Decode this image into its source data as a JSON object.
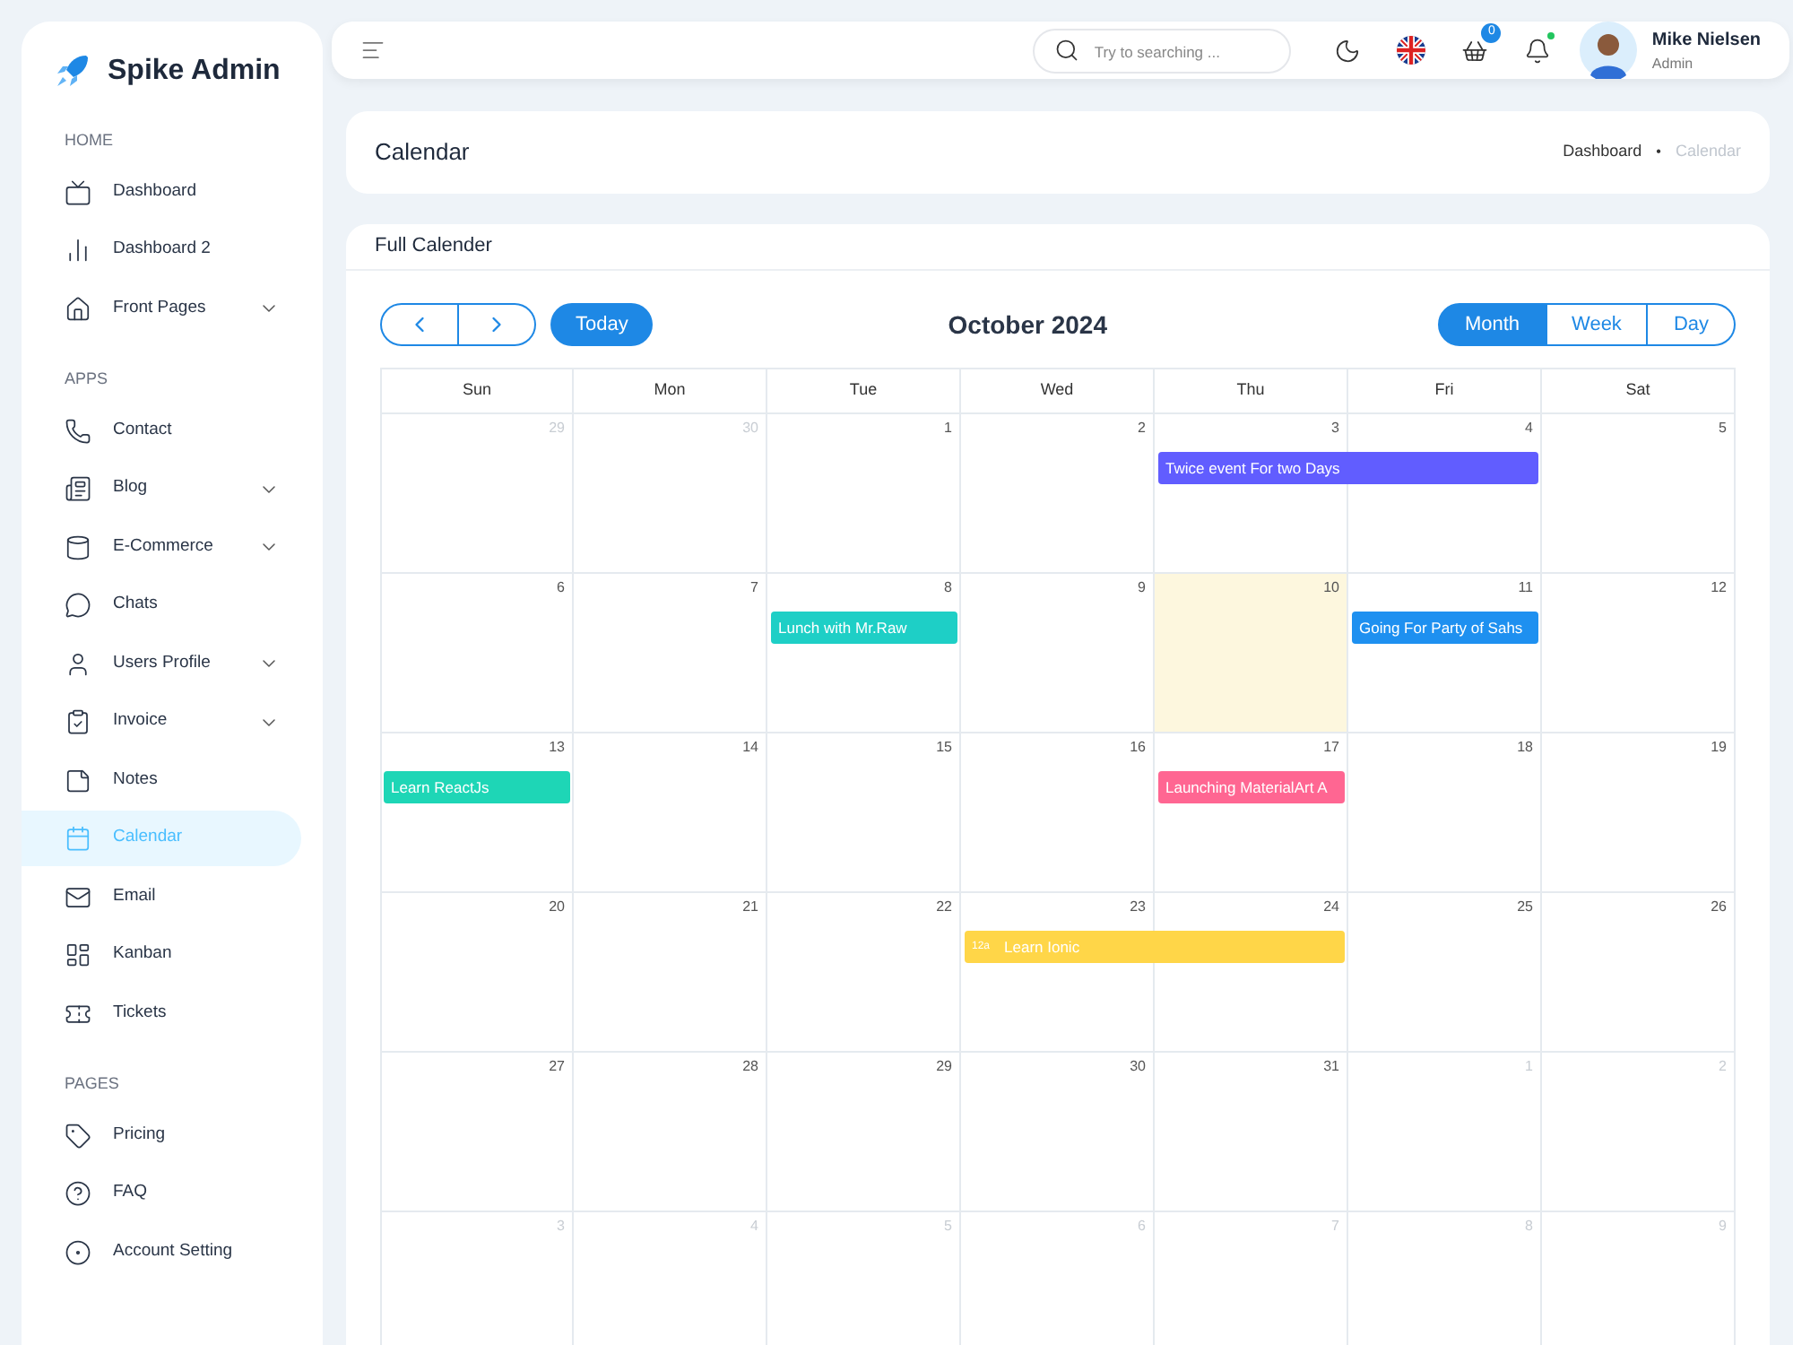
{
  "brand": {
    "name": "Spike Admin"
  },
  "sidebar": {
    "sections": [
      {
        "title": "HOME",
        "items": [
          {
            "label": "Dashboard",
            "has_submenu": false,
            "selected": false
          },
          {
            "label": "Dashboard 2",
            "has_submenu": false,
            "selected": false
          },
          {
            "label": "Front Pages",
            "has_submenu": true,
            "selected": false
          }
        ]
      },
      {
        "title": "APPS",
        "items": [
          {
            "label": "Contact",
            "has_submenu": false,
            "selected": false
          },
          {
            "label": "Blog",
            "has_submenu": true,
            "selected": false
          },
          {
            "label": "E-Commerce",
            "has_submenu": true,
            "selected": false
          },
          {
            "label": "Chats",
            "has_submenu": false,
            "selected": false
          },
          {
            "label": "Users Profile",
            "has_submenu": true,
            "selected": false
          },
          {
            "label": "Invoice",
            "has_submenu": true,
            "selected": false
          },
          {
            "label": "Notes",
            "has_submenu": false,
            "selected": false
          },
          {
            "label": "Calendar",
            "has_submenu": false,
            "selected": true
          },
          {
            "label": "Email",
            "has_submenu": false,
            "selected": false
          },
          {
            "label": "Kanban",
            "has_submenu": false,
            "selected": false
          },
          {
            "label": "Tickets",
            "has_submenu": false,
            "selected": false
          }
        ]
      },
      {
        "title": "PAGES",
        "items": [
          {
            "label": "Pricing",
            "has_submenu": false,
            "selected": false
          },
          {
            "label": "FAQ",
            "has_submenu": false,
            "selected": false
          },
          {
            "label": "Account Setting",
            "has_submenu": false,
            "selected": false
          }
        ]
      }
    ]
  },
  "header": {
    "search": {
      "placeholder": "Try to searching ..."
    },
    "cart_badge": "0",
    "notification_dot": true,
    "user": {
      "name": "Mike Nielsen",
      "role": "Admin"
    }
  },
  "page_title": {
    "title": "Calendar",
    "breadcrumb": [
      {
        "label": "Dashboard",
        "selected": false
      },
      {
        "label": "Calendar",
        "selected": true
      }
    ],
    "separator": "•"
  },
  "calendar": {
    "card_title": "Full Calender",
    "today_button": "Today",
    "month_title": "October 2024",
    "views": [
      {
        "label": "Month",
        "selected": true
      },
      {
        "label": "Week",
        "selected": false
      },
      {
        "label": "Day",
        "selected": false
      }
    ],
    "weekdays": [
      "Sun",
      "Mon",
      "Tue",
      "Wed",
      "Thu",
      "Fri",
      "Sat"
    ],
    "weeks": [
      {
        "days": [
          {
            "label": "29",
            "muted": true,
            "today": false
          },
          {
            "label": "30",
            "muted": true,
            "today": false
          },
          {
            "label": "1",
            "muted": false,
            "today": false
          },
          {
            "label": "2",
            "muted": false,
            "today": false
          },
          {
            "label": "3",
            "muted": false,
            "today": false,
            "events": [
              {
                "title": "Twice event For two Days",
                "color": "#615dff",
                "two_days": true
              }
            ]
          },
          {
            "label": "4",
            "muted": false,
            "today": false
          },
          {
            "label": "5",
            "muted": false,
            "today": false
          }
        ]
      },
      {
        "days": [
          {
            "label": "6",
            "muted": false,
            "today": false
          },
          {
            "label": "7",
            "muted": false,
            "today": false
          },
          {
            "label": "8",
            "muted": false,
            "today": false,
            "events": [
              {
                "title": "Lunch with Mr.Raw",
                "color": "#1ecfc6",
                "two_days": false
              }
            ]
          },
          {
            "label": "9",
            "muted": false,
            "today": false
          },
          {
            "label": "10",
            "muted": false,
            "today": true
          },
          {
            "label": "11",
            "muted": false,
            "today": false,
            "events": [
              {
                "title": "Going For Party of Sahs",
                "color": "#1e90f0",
                "two_days": false
              }
            ]
          },
          {
            "label": "12",
            "muted": false,
            "today": false
          }
        ]
      },
      {
        "days": [
          {
            "label": "13",
            "muted": false,
            "today": false,
            "events": [
              {
                "title": "Learn ReactJs",
                "color": "#1ed6b6",
                "two_days": false
              }
            ]
          },
          {
            "label": "14",
            "muted": false,
            "today": false
          },
          {
            "label": "15",
            "muted": false,
            "today": false
          },
          {
            "label": "16",
            "muted": false,
            "today": false
          },
          {
            "label": "17",
            "muted": false,
            "today": false,
            "events": [
              {
                "title": "Launching MaterialArt A",
                "color": "#ff6692",
                "two_days": false
              }
            ]
          },
          {
            "label": "18",
            "muted": false,
            "today": false
          },
          {
            "label": "19",
            "muted": false,
            "today": false
          }
        ]
      },
      {
        "days": [
          {
            "label": "20",
            "muted": false,
            "today": false
          },
          {
            "label": "21",
            "muted": false,
            "today": false
          },
          {
            "label": "22",
            "muted": false,
            "today": false
          },
          {
            "label": "23",
            "muted": false,
            "today": false,
            "events": [
              {
                "title": "Learn Ionic",
                "time": "12a",
                "color": "#ffd648",
                "two_days": true
              }
            ]
          },
          {
            "label": "24",
            "muted": false,
            "today": false
          },
          {
            "label": "25",
            "muted": false,
            "today": false
          },
          {
            "label": "26",
            "muted": false,
            "today": false
          }
        ]
      },
      {
        "days": [
          {
            "label": "27",
            "muted": false,
            "today": false
          },
          {
            "label": "28",
            "muted": false,
            "today": false
          },
          {
            "label": "29",
            "muted": false,
            "today": false
          },
          {
            "label": "30",
            "muted": false,
            "today": false
          },
          {
            "label": "31",
            "muted": false,
            "today": false
          },
          {
            "label": "1",
            "muted": true,
            "today": false
          },
          {
            "label": "2",
            "muted": true,
            "today": false
          }
        ]
      },
      {
        "days": [
          {
            "label": "3",
            "muted": true,
            "today": false
          },
          {
            "label": "4",
            "muted": true,
            "today": false
          },
          {
            "label": "5",
            "muted": true,
            "today": false
          },
          {
            "label": "6",
            "muted": true,
            "today": false
          },
          {
            "label": "7",
            "muted": true,
            "today": false
          },
          {
            "label": "8",
            "muted": true,
            "today": false
          },
          {
            "label": "9",
            "muted": true,
            "today": false
          }
        ]
      }
    ]
  }
}
